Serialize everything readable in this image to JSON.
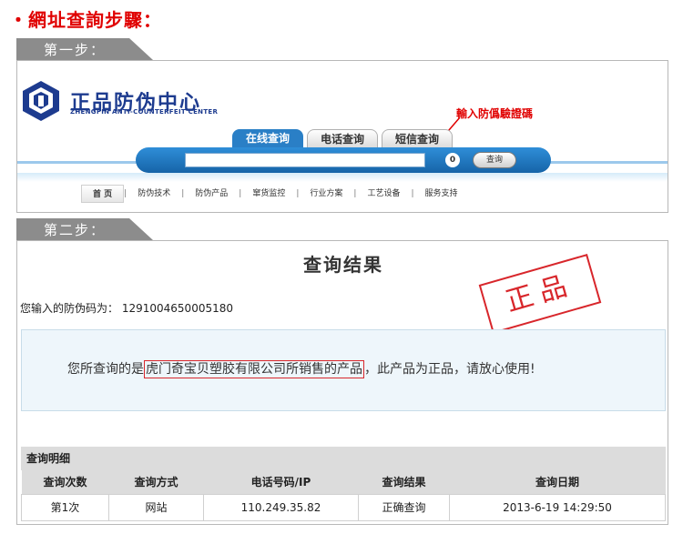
{
  "page_title": "・網址查詢步驟：",
  "steps": [
    {
      "label": "第一步："
    },
    {
      "label": "第二步："
    }
  ],
  "site": {
    "brand_cn": "正品防伪中心",
    "brand_en": "ZHENGPIN ANTI-COUNTERFEIT CENTER",
    "tabs": [
      {
        "label": "在线查询",
        "active": true
      },
      {
        "label": "电话查询",
        "active": false
      },
      {
        "label": "短信查询",
        "active": false
      }
    ],
    "annotation": "輸入防僞驗證碼",
    "search_placeholder": "",
    "counter": "0",
    "search_button": "查询",
    "nav": [
      "首 页",
      "防伪技术",
      "防伪产品",
      "窜货监控",
      "行业方案",
      "工艺设备",
      "服务支持"
    ]
  },
  "result": {
    "title": "查询结果",
    "code_label": "您输入的防伪码为：",
    "code_value": "1291004650005180",
    "stamp": "正品",
    "message_prefix": "您所查询的是",
    "message_highlight": "虎门奇宝贝塑胶有限公司所销售的产品",
    "message_suffix": "，此产品为正品，请放心使用!",
    "detail_heading": "查询明细",
    "columns": [
      "查询次数",
      "查询方式",
      "电话号码/IP",
      "查询结果",
      "查询日期"
    ],
    "rows": [
      [
        "第1次",
        "网站",
        "110.249.35.82",
        "正确查询",
        "2013-6-19 14:29:50"
      ]
    ]
  },
  "colors": {
    "accent_red": "#e00000",
    "brand_blue": "#1d3b8f",
    "tab_blue": "#2a7fc6"
  }
}
